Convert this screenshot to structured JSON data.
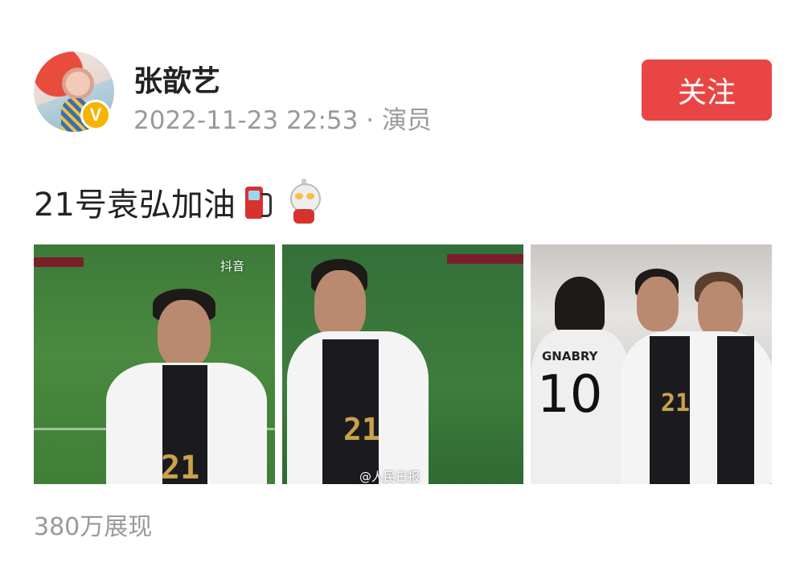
{
  "author": {
    "name": "张歆艺",
    "timestamp": "2022-11-23 22:53",
    "separator": "·",
    "role": "演员",
    "verified_icon": "verified-v-icon"
  },
  "actions": {
    "follow_label": "关注"
  },
  "post": {
    "text": "21号袁弘加油",
    "emojis": [
      "fuel-pump-emoji",
      "ultraman-emoji"
    ]
  },
  "photos": [
    {
      "watermark": "抖音",
      "jersey_number": "21"
    },
    {
      "watermark": "@人民日报",
      "jersey_number": "21"
    },
    {
      "name_label": "GNABRY",
      "back_number": "10",
      "jersey_number": "21"
    }
  ],
  "stats": {
    "views": "380万展现"
  },
  "colors": {
    "follow_button": "#e94545",
    "meta_text": "#999999"
  }
}
